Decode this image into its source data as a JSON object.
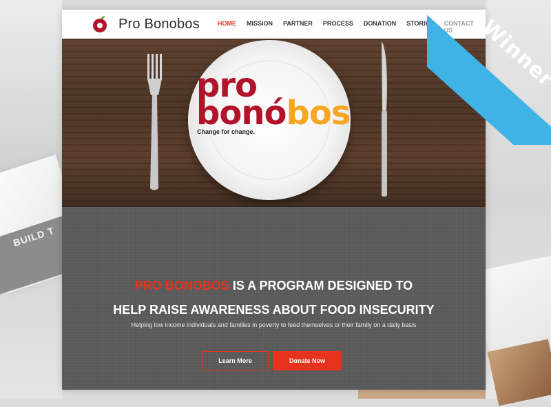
{
  "site": {
    "logo_text": "Pro Bonobos",
    "nav": [
      "HOME",
      "MISSION",
      "PARTNER",
      "PROCESS",
      "DONATION",
      "STORIES",
      "CONTACT US"
    ]
  },
  "hero": {
    "brand_line1": "pro",
    "brand_line2_a": "bonó",
    "brand_line2_b": "bos",
    "tagline": "Change for change."
  },
  "content": {
    "headline_accent": "PRO BONOBOS",
    "headline_rest": " IS A PROGRAM DESIGNED TO",
    "headline_line2": "HELP RAISE AWARENESS ABOUT FOOD INSECURITY",
    "subline": "Helping low income individuals and families in poverty to feed themselves or their family on a daily basis",
    "learn_more": "Learn More",
    "donate_now": "Donate Now"
  },
  "ribbon": {
    "label": "Winner"
  },
  "background": {
    "ghost_text": "BUILD T"
  },
  "colors": {
    "accent": "#e5331d",
    "ribbon": "#3fb3e6",
    "brand_red": "#b0132a",
    "brand_orange": "#f5a623"
  }
}
